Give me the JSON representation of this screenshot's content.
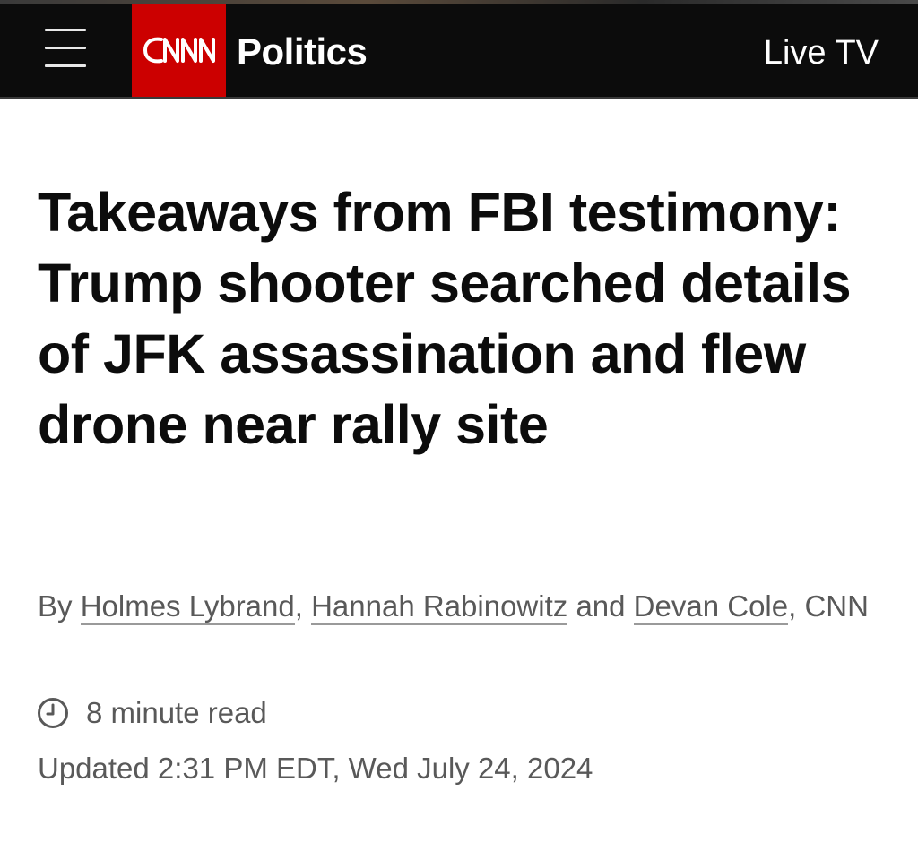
{
  "header": {
    "brand_name": "CNN",
    "section": "Politics",
    "live_tv": "Live TV",
    "colors": {
      "bar": "#0c0c0c",
      "logo_bg": "#cc0000"
    }
  },
  "article": {
    "headline": "Takeaways from FBI testimony: Trump shooter searched details of JFK assassination and flew drone near rally site",
    "byline": {
      "prefix": "By",
      "authors": [
        "Holmes Lybrand",
        "Hannah Rabinowitz",
        "Devan Cole"
      ],
      "sep1": ",",
      "conjunction": "and",
      "suffix": ", CNN"
    },
    "read_time": "8 minute read",
    "updated": "Updated 2:31 PM EDT, Wed July 24, 2024"
  },
  "icons": {
    "menu": "hamburger-menu-icon",
    "clock": "clock-icon"
  }
}
